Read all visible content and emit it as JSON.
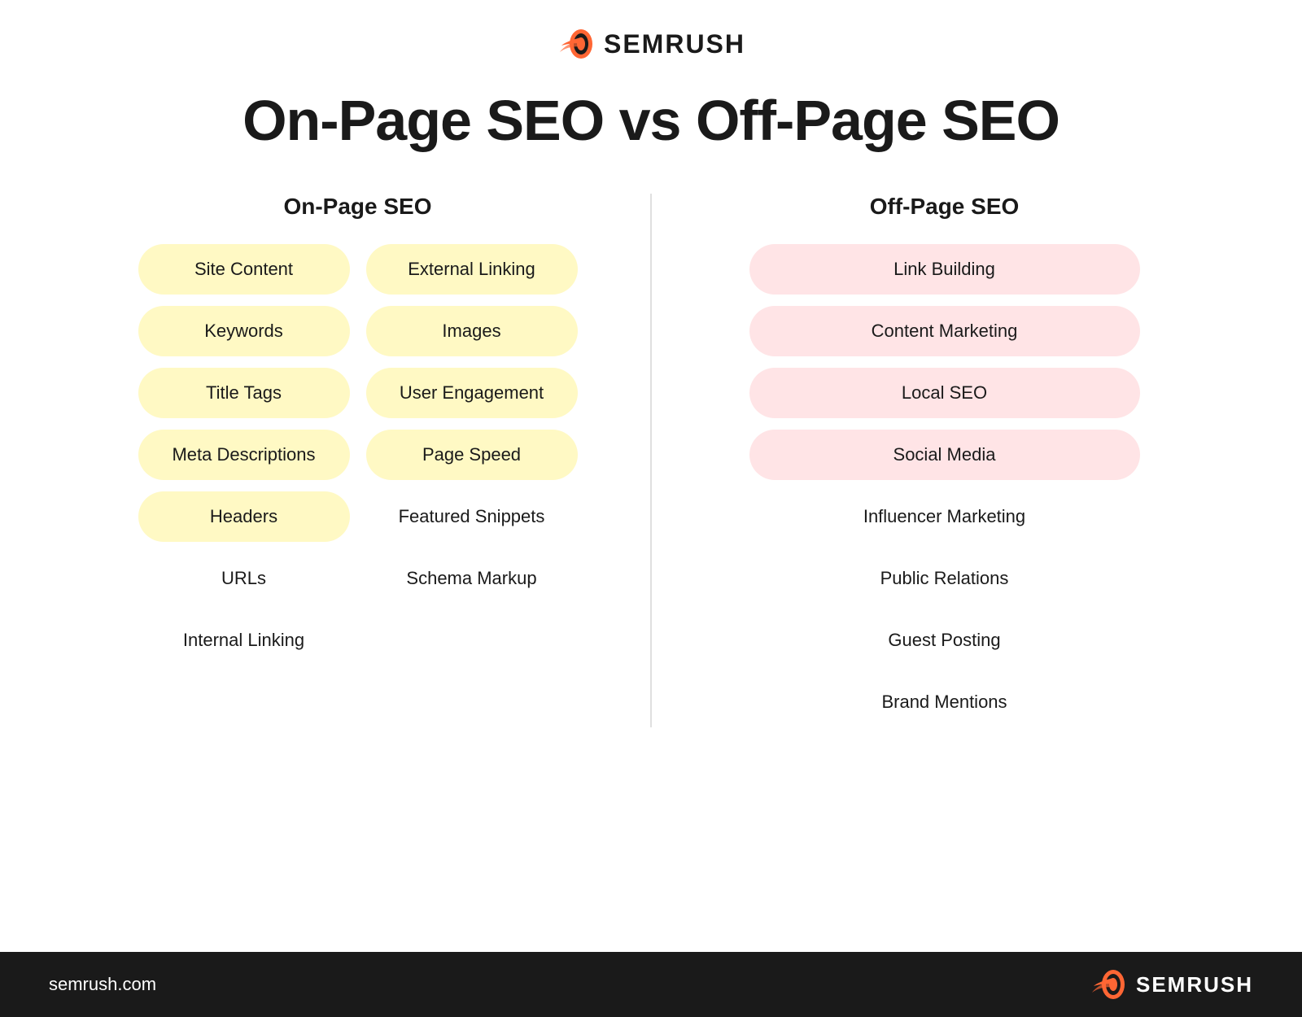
{
  "logo": {
    "text": "SEMRUSH",
    "url": "semrush.com"
  },
  "page_title": "On-Page SEO vs Off-Page SEO",
  "onpage": {
    "column_title": "On-Page SEO",
    "col1": [
      "Site Content",
      "Keywords",
      "Title Tags",
      "Meta Descriptions",
      "Headers",
      "URLs",
      "Internal Linking"
    ],
    "col2": [
      "External Linking",
      "Images",
      "User Engagement",
      "Page Speed",
      "Featured Snippets",
      "Schema Markup"
    ]
  },
  "offpage": {
    "column_title": "Off-Page SEO",
    "items_pink": [
      "Link Building",
      "Content Marketing",
      "Local SEO",
      "Social Media"
    ],
    "items_plain": [
      "Influencer Marketing",
      "Public Relations",
      "Guest Posting",
      "Brand Mentions"
    ]
  },
  "colors": {
    "yellow_pill": "#FFF9C4",
    "pink_pill": "#FFE4E6",
    "accent": "#FF6634",
    "dark": "#1a1a1a",
    "white": "#ffffff"
  }
}
